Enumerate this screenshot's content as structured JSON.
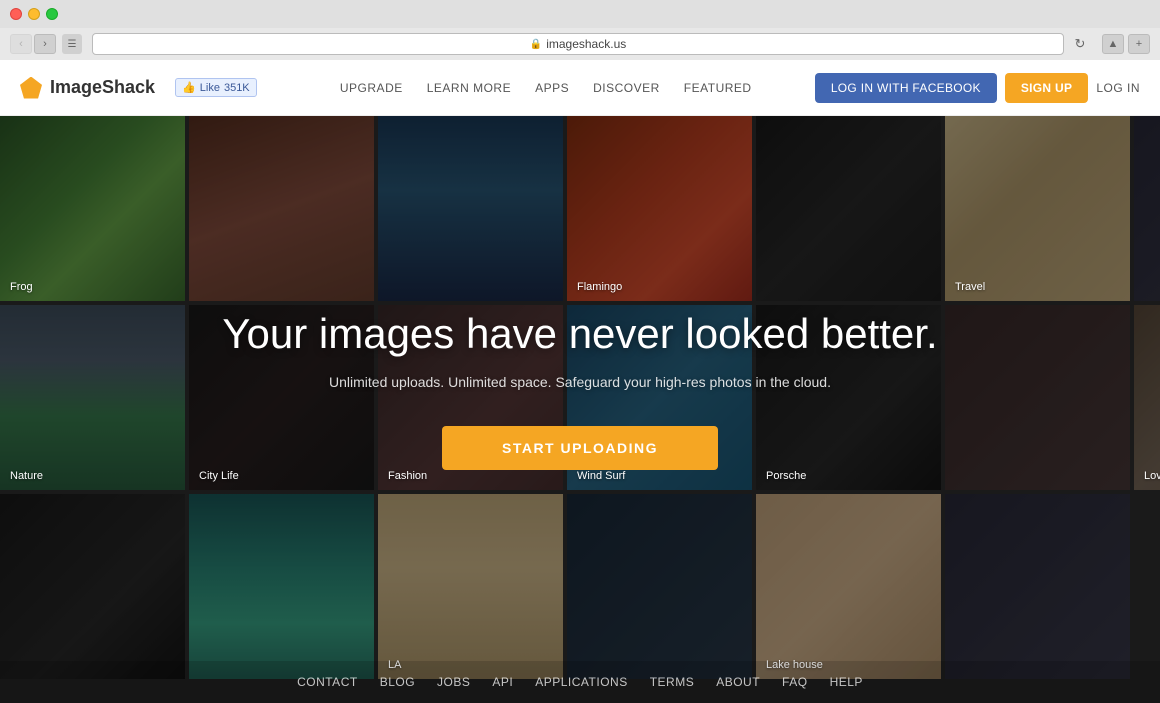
{
  "browser": {
    "url": "imageshack.us",
    "back_title": "back",
    "forward_title": "forward"
  },
  "navbar": {
    "brand_name": "ImageShack",
    "fb_like_label": "Like",
    "fb_like_count": "351K",
    "links": [
      {
        "label": "UPGRADE",
        "id": "upgrade"
      },
      {
        "label": "LEARN MORE",
        "id": "learn-more"
      },
      {
        "label": "APPS",
        "id": "apps"
      },
      {
        "label": "DISCOVER",
        "id": "discover"
      },
      {
        "label": "FEATURED",
        "id": "featured"
      }
    ],
    "btn_facebook": "LOG IN WITH FACEBOOK",
    "btn_signup": "SIGN UP",
    "btn_login": "LOG IN"
  },
  "hero": {
    "title": "Your images have never looked better.",
    "subtitle": "Unlimited uploads. Unlimited space. Safeguard your high-res photos in the cloud.",
    "cta_label": "START UPLOADING"
  },
  "grid": [
    {
      "label": "Frog",
      "class": "img-frog"
    },
    {
      "label": "",
      "class": "img-hands"
    },
    {
      "label": "",
      "class": "img-ocean"
    },
    {
      "label": "Flamingo",
      "class": "img-flamingo"
    },
    {
      "label": "",
      "class": "img-man"
    },
    {
      "label": "Travel",
      "class": "img-mosque"
    },
    {
      "label": "",
      "class": "img-extra1"
    },
    {
      "label": "Nature",
      "class": "img-mountains"
    },
    {
      "label": "City Life",
      "class": "img-citylife"
    },
    {
      "label": "Fashion",
      "class": "img-fashion"
    },
    {
      "label": "Wind Surf",
      "class": "img-windsurf"
    },
    {
      "label": "Porsche",
      "class": "img-porsche"
    },
    {
      "label": "",
      "class": "img-extra2"
    },
    {
      "label": "Love",
      "class": "img-love"
    },
    {
      "label": "",
      "class": "img-wolf"
    },
    {
      "label": "",
      "class": "img-ocean2"
    },
    {
      "label": "LA",
      "class": "img-la"
    },
    {
      "label": "",
      "class": "img-extra3"
    },
    {
      "label": "",
      "class": "img-extra2"
    },
    {
      "label": "Lake house",
      "class": "img-lakehouse"
    },
    {
      "label": "",
      "class": "img-extra1"
    }
  ],
  "footer": {
    "links": [
      {
        "label": "CONTACT",
        "id": "contact"
      },
      {
        "label": "BLOG",
        "id": "blog"
      },
      {
        "label": "JOBS",
        "id": "jobs"
      },
      {
        "label": "API",
        "id": "api"
      },
      {
        "label": "APPLICATIONS",
        "id": "applications"
      },
      {
        "label": "TERMS",
        "id": "terms"
      },
      {
        "label": "ABOUT",
        "id": "about"
      },
      {
        "label": "FAQ",
        "id": "faq"
      },
      {
        "label": "HELP",
        "id": "help"
      }
    ]
  }
}
